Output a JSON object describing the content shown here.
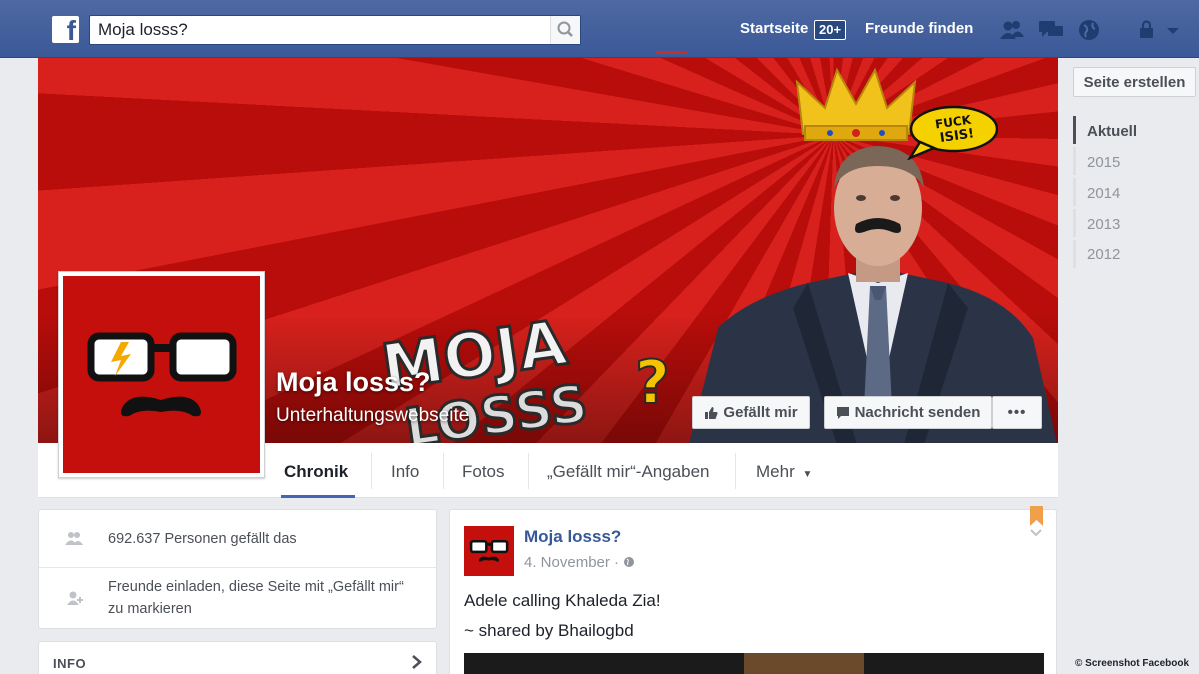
{
  "topbar": {
    "search_value": "Moja losss?",
    "nav": {
      "home": "Startseite",
      "home_badge": "20+",
      "find_friends": "Freunde finden"
    },
    "icons": [
      "facebook-logo-icon",
      "search-icon",
      "friend-requests-icon",
      "messages-icon",
      "notifications-globe-icon",
      "lock-icon",
      "menu-chevron-icon"
    ]
  },
  "page": {
    "title": "Moja losss?",
    "category": "Unterhaltungswebseite",
    "cover_logo_text": "MOJA LOSSS?",
    "cover_bubble_text": "FUCK ISIS!",
    "buttons": {
      "like": "Gefällt mir",
      "message": "Nachricht senden",
      "more": "•••"
    },
    "tabs": [
      {
        "label": "Chronik",
        "active": true
      },
      {
        "label": "Info"
      },
      {
        "label": "Fotos"
      },
      {
        "label": "„Gefällt mir“-Angaben"
      },
      {
        "label": "Mehr"
      }
    ]
  },
  "left_column": {
    "likes_text": "692.637 Personen gefällt das",
    "invite_text_line1": "Freunde einladen, diese Seite mit „Gefällt mir“",
    "invite_text_line2": "zu markieren",
    "info_heading": "INFO"
  },
  "post": {
    "author": "Moja losss?",
    "date": "4. November",
    "line1": "Adele calling Khaleda Zia!",
    "line2": "~ shared by Bhailogbd"
  },
  "sidebar": {
    "create_page_label": "Seite erstellen",
    "years": [
      "Aktuell",
      "2015",
      "2014",
      "2013",
      "2012"
    ]
  },
  "credit": "© Screenshot Facebook",
  "colors": {
    "facebook_blue": "#3b5998",
    "cover_red": "#c40f0c",
    "link_blue": "#365899"
  }
}
